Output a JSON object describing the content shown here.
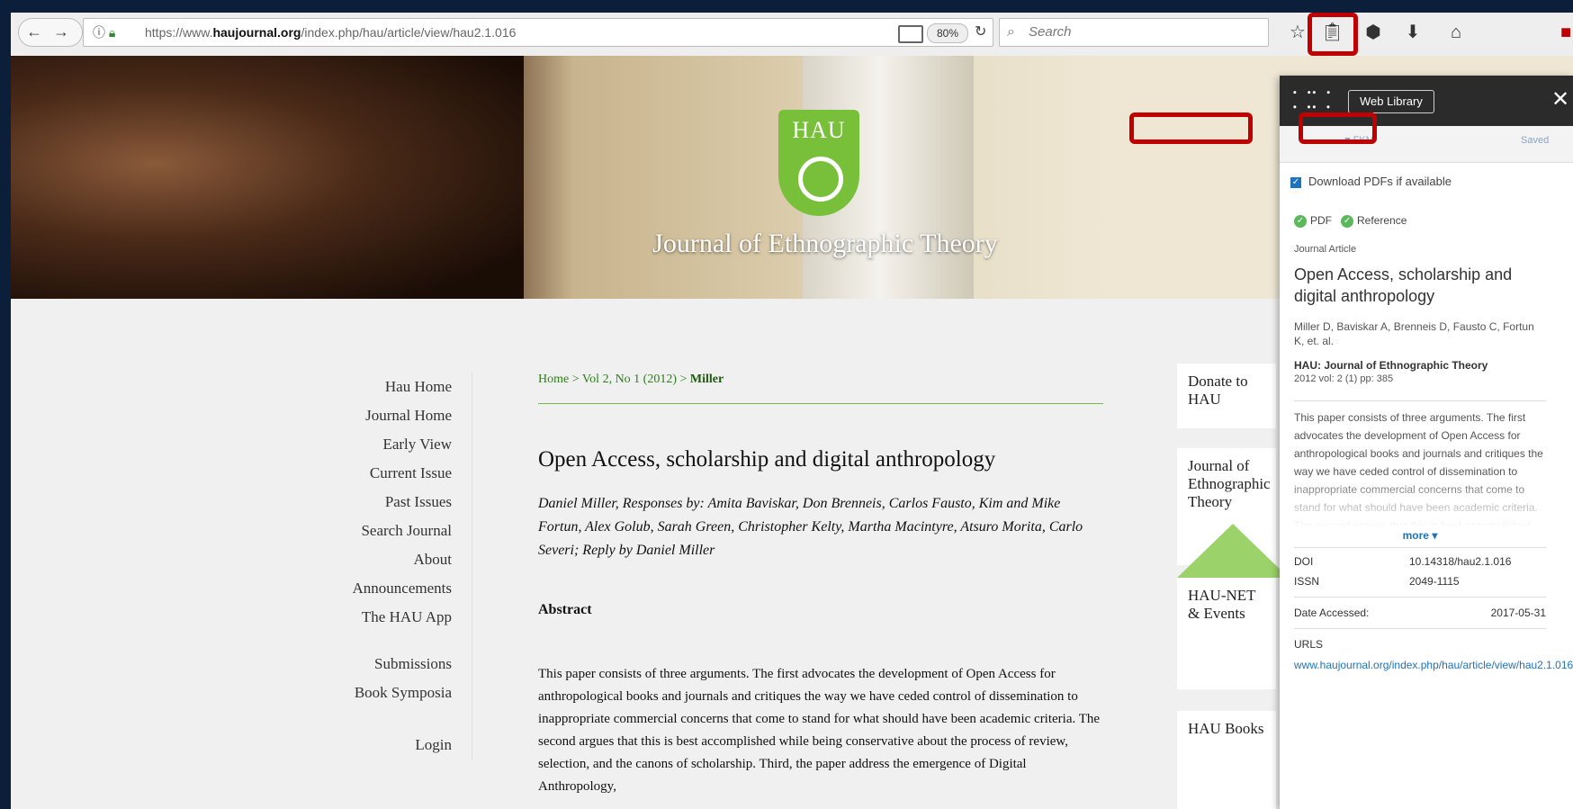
{
  "browser": {
    "url_prefix": "https://www.",
    "url_domain": "haujournal.org",
    "url_path": "/index.php/hau/article/view/hau2.1.016",
    "zoom": "80%",
    "search_placeholder": "Search"
  },
  "banner": {
    "logo_text": "HAU",
    "journal_title": "Journal of Ethnographic Theory"
  },
  "leftnav": {
    "items": [
      "Hau Home",
      "Journal Home",
      "Early View",
      "Current Issue",
      "Past Issues",
      "Search Journal",
      "About",
      "Announcements",
      "The HAU App"
    ],
    "items2": [
      "Submissions",
      "Book Symposia"
    ],
    "login": "Login"
  },
  "article": {
    "crumb_home": "Home",
    "crumb_sep1": " > ",
    "crumb_vol": "Vol 2, No 1 (2012)",
    "crumb_sep2": " > ",
    "crumb_current": "Miller",
    "title": "Open Access, scholarship and digital anthropology",
    "authors": "Daniel Miller, Responses by: Amita Baviskar, Don Brenneis, Carlos Fausto, Kim and Mike Fortun, Alex Golub, Sarah Green, Christopher Kelty, Martha Macintyre, Atsuro Morita, Carlo Severi; Reply by Daniel Miller",
    "abstract_heading": "Abstract",
    "abstract": "This paper consists of three arguments. The first advocates the development of Open Access for anthropological books and journals and critiques the way we have ceded control of dissemination to inappropriate commercial concerns that come to stand for what should have been academic criteria. The second argues that this is best accomplished while being conservative about the process of review, selection, and the canons of scholarship. Third, the paper address the emergence of Digital Anthropology,"
  },
  "rightcol": {
    "donate": "Donate to HAU",
    "journal": "Journal of Ethnographic Theory",
    "haunet": "HAU-NET & Events",
    "books": "HAU Books"
  },
  "panel": {
    "web_library": "Web Library",
    "close": "✕",
    "tab_left": "FKM",
    "tab_right": "Saved",
    "download_label": "Download PDFs if available",
    "pdf": "PDF",
    "reference": "Reference",
    "type": "Journal Article",
    "title": "Open Access, scholarship and digital anthropology",
    "authors": "Miller D,  Baviskar A,  Brenneis D,  Fausto C,  Fortun K,  et. al.",
    "journal": "HAU: Journal of Ethnographic Theory",
    "volume": "2012 vol: 2 (1) pp: 385",
    "abstract": "This paper consists of three arguments. The first advocates the development of Open Access for anthropological books and journals and critiques the way we have ceded control of dissemination to inappropriate commercial concerns that come to stand for what should have been academic criteria. The second argues that this is best accomplished while",
    "more": "more ▾",
    "doi_label": "DOI",
    "doi": "10.14318/hau2.1.016",
    "issn_label": "ISSN",
    "issn": "2049-1115",
    "date_label": "Date Accessed:",
    "date": "2017-05-31",
    "urls_label": "URLS",
    "url": "www.haujournal.org/index.php/hau/article/view/hau2.1.016"
  },
  "colors": {
    "accent_green": "#78c03a",
    "highlight_red": "#c00000",
    "link_blue": "#1e73be"
  }
}
